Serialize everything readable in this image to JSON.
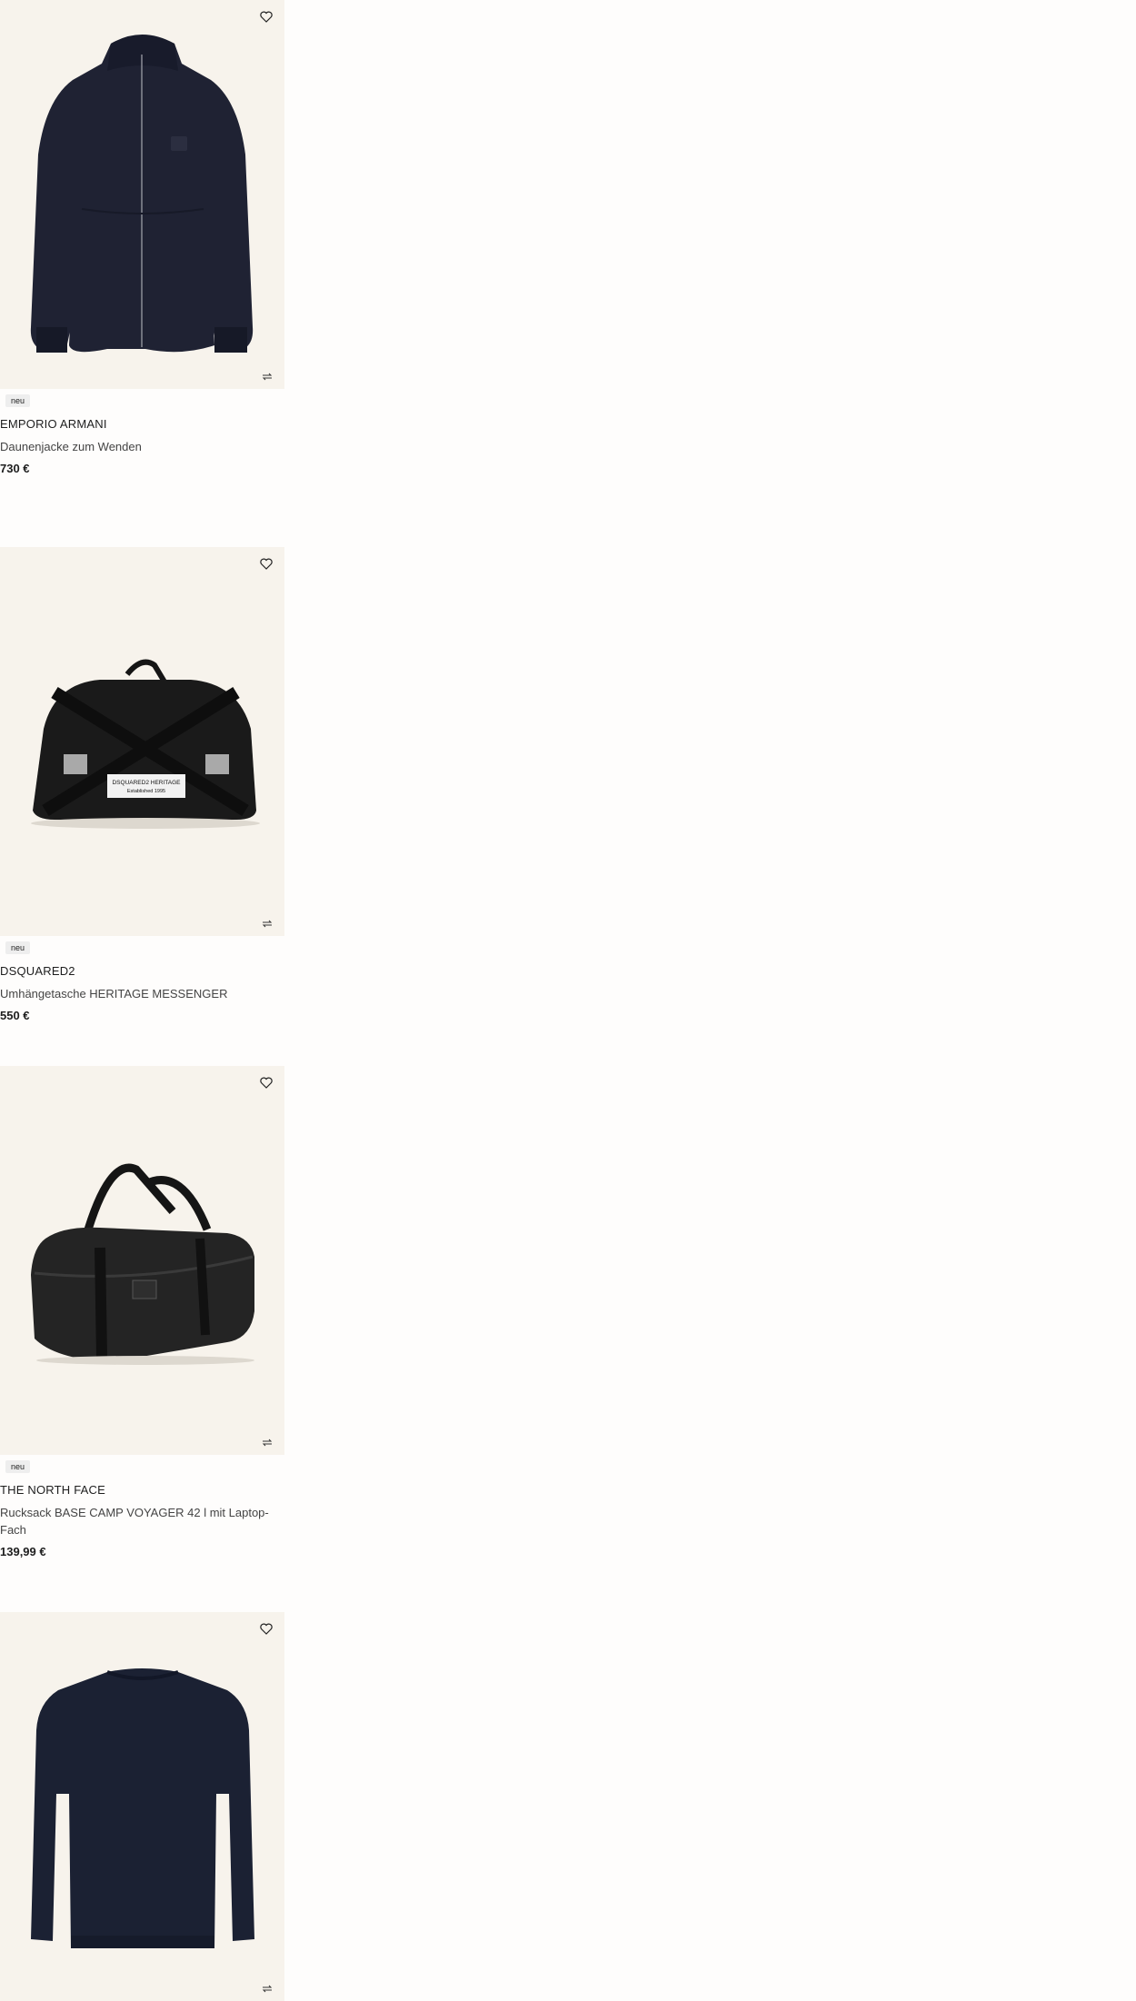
{
  "products": [
    {
      "badge": "neu",
      "brand": "EMPORIO ARMANI",
      "title": "Daunenjacke zum Wenden",
      "price": "730 €",
      "image": "puffer-jacket",
      "wishlist_icon": "heart-icon",
      "swap_icon": "swap-icon"
    },
    {
      "badge": "neu",
      "brand": "DSQUARED2",
      "title": "Umhängetasche HERITAGE MESSENGER",
      "price": "550 €",
      "image": "messenger-bag",
      "image_text_1": "DSQUARED2 HERITAGE",
      "image_text_2": "Established 1995",
      "wishlist_icon": "heart-icon",
      "swap_icon": "swap-icon"
    },
    {
      "badge": "neu",
      "brand": "THE NORTH FACE",
      "title": "Rucksack BASE CAMP VOYAGER 42 l mit Laptop-Fach",
      "price": "139,99 €",
      "image": "duffel-bag",
      "wishlist_icon": "heart-icon",
      "swap_icon": "swap-icon"
    },
    {
      "image": "navy-sweater",
      "wishlist_icon": "heart-icon",
      "swap_icon": "swap-icon"
    }
  ],
  "colors": {
    "image_bg": "#f7f3ec",
    "badge_bg": "#eeeeee",
    "text": "#1e1e1e"
  }
}
